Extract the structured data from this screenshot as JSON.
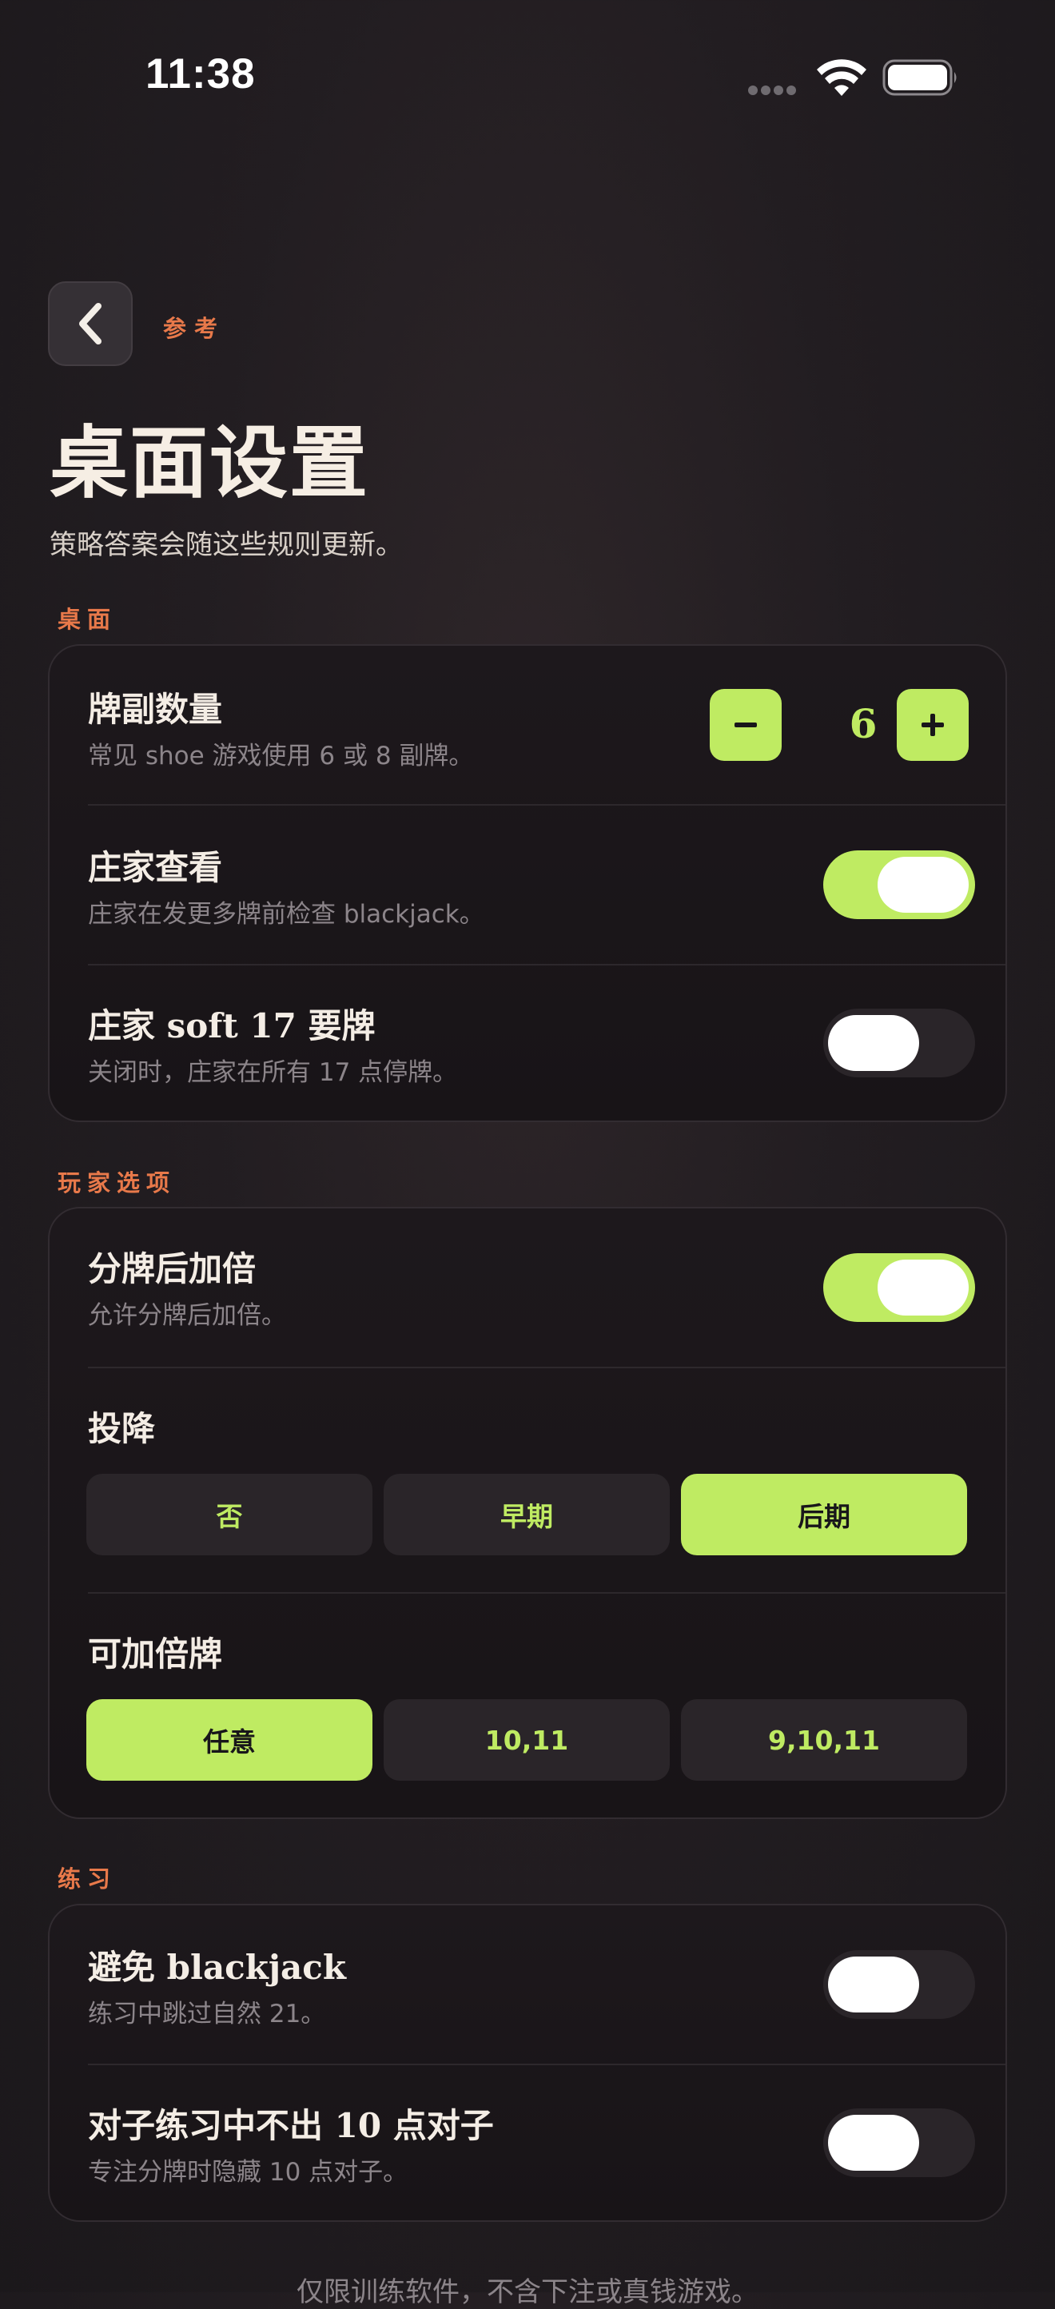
{
  "status_bar": {
    "time": "11:38"
  },
  "header": {
    "back_icon": "chevron-left-icon",
    "breadcrumb": "参考",
    "title": "桌面设置",
    "subtitle": "策略答案会随这些规则更新。"
  },
  "sections": {
    "table": {
      "label": "桌面",
      "deck_count": {
        "title": "牌副数量",
        "desc": "常见 shoe 游戏使用 6 或 8 副牌。",
        "value": "6",
        "minus_icon": "minus-icon",
        "plus_icon": "plus-icon"
      },
      "dealer_peek": {
        "title": "庄家查看",
        "desc": "庄家在发更多牌前检查 blackjack。",
        "enabled": true
      },
      "dealer_hits_soft17": {
        "title": "庄家 soft 17 要牌",
        "desc": "关闭时，庄家在所有 17 点停牌。",
        "enabled": false
      }
    },
    "player": {
      "label": "玩家选项",
      "das": {
        "title": "分牌后加倍",
        "desc": "允许分牌后加倍。",
        "enabled": true
      },
      "surrender": {
        "title": "投降",
        "options": [
          "否",
          "早期",
          "后期"
        ],
        "selected": "后期"
      },
      "double_on": {
        "title": "可加倍牌",
        "options": [
          "任意",
          "10,11",
          "9,10,11"
        ],
        "selected": "任意"
      }
    },
    "practice": {
      "label": "练习",
      "avoid_blackjack": {
        "title": "避免 blackjack",
        "desc": "练习中跳过自然 21。",
        "enabled": false
      },
      "no_ten_pairs": {
        "title": "对子练习中不出 10 点对子",
        "desc": "专注分牌时隐藏 10 点对子。",
        "enabled": false
      }
    }
  },
  "footer": {
    "note": "仅限训练软件，不含下注或真钱游戏。"
  },
  "colors": {
    "accent": "#bfeb62",
    "section_label": "#e8794a",
    "background": "#221d21",
    "card": "#1b171a"
  }
}
